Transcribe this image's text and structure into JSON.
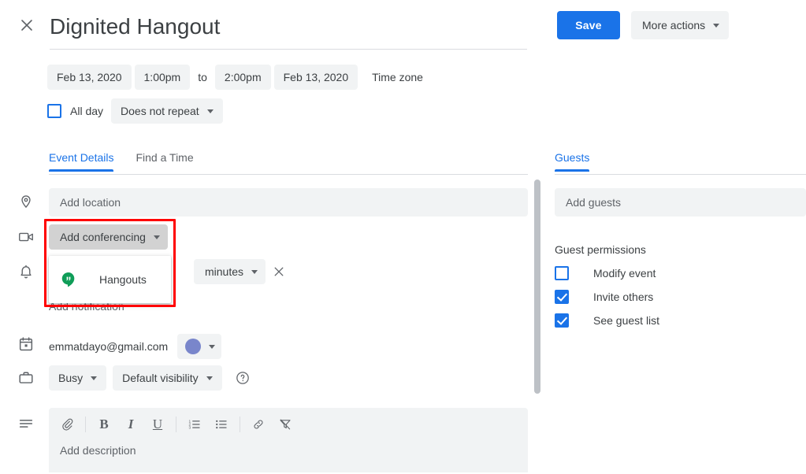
{
  "header": {
    "close_icon": "close-icon",
    "title": "Dignited Hangout",
    "save_label": "Save",
    "more_actions_label": "More actions"
  },
  "schedule": {
    "start_date": "Feb 13, 2020",
    "start_time": "1:00pm",
    "to_label": "to",
    "end_time": "2:00pm",
    "end_date": "Feb 13, 2020",
    "time_zone_label": "Time zone",
    "all_day_label": "All day",
    "all_day_checked": false,
    "repeat_label": "Does not repeat"
  },
  "tabs": {
    "left": [
      {
        "label": "Event Details",
        "active": true
      },
      {
        "label": "Find a Time",
        "active": false
      }
    ],
    "right": [
      {
        "label": "Guests",
        "active": true
      }
    ]
  },
  "details": {
    "location_placeholder": "Add location",
    "conferencing_label": "Add conferencing",
    "conferencing_menu": [
      {
        "label": "Hangouts",
        "icon": "hangouts-icon"
      }
    ],
    "notification_units_label": "minutes",
    "notification_remove_icon": "close-icon",
    "add_notification_label": "Add notification",
    "calendar_email": "emmatdayo@gmail.com",
    "event_color": "#7986cb",
    "busy_label": "Busy",
    "visibility_label": "Default visibility",
    "help_icon": "help-icon",
    "description_placeholder": "Add description",
    "description_toolbar": [
      {
        "name": "attach-icon",
        "glyph": "attach"
      },
      {
        "name": "bold-icon",
        "glyph": "B"
      },
      {
        "name": "italic-icon",
        "glyph": "I"
      },
      {
        "name": "underline-icon",
        "glyph": "U"
      },
      {
        "name": "numbered-list-icon",
        "glyph": "ol"
      },
      {
        "name": "bulleted-list-icon",
        "glyph": "ul"
      },
      {
        "name": "link-icon",
        "glyph": "link"
      },
      {
        "name": "remove-formatting-icon",
        "glyph": "clear"
      }
    ]
  },
  "guests": {
    "add_guests_placeholder": "Add guests",
    "permissions_title": "Guest permissions",
    "permissions": [
      {
        "label": "Modify event",
        "checked": false
      },
      {
        "label": "Invite others",
        "checked": true
      },
      {
        "label": "See guest list",
        "checked": true
      }
    ]
  },
  "rail_icons": [
    "location-pin-icon",
    "video-camera-icon",
    "bell-icon",
    "calendar-icon",
    "briefcase-icon",
    "description-lines-icon"
  ],
  "annotation": {
    "highlight_color": "#ff0000"
  }
}
